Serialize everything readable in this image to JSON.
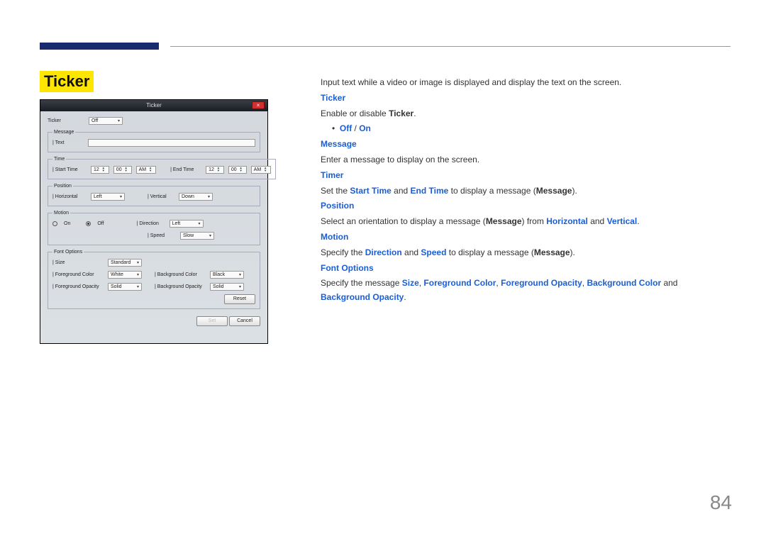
{
  "page_number": "84",
  "section_title": "Ticker",
  "dialog": {
    "title": "Ticker",
    "close_x": "×",
    "ticker_label": "Ticker",
    "ticker_value": "Off",
    "message_legend": "Message",
    "message_text_label": "Text",
    "message_text_value": "",
    "time_legend": "Time",
    "start_time_label": "Start Time",
    "start_h": "12",
    "start_m": "00",
    "start_ap": "AM",
    "end_time_label": "End Time",
    "end_h": "12",
    "end_m": "00",
    "end_ap": "AM",
    "position_legend": "Position",
    "horizontal_label": "Horizontal",
    "horizontal_value": "Left",
    "vertical_label": "Vertical",
    "vertical_value": "Down",
    "motion_legend": "Motion",
    "on_label": "On",
    "off_label": "Off",
    "direction_label": "Direction",
    "direction_value": "Left",
    "speed_label": "Speed",
    "speed_value": "Slow",
    "font_legend": "Font Options",
    "size_label": "Size",
    "size_value": "Standard",
    "fg_color_label": "Foreground Color",
    "fg_color_value": "White",
    "bg_color_label": "Background Color",
    "bg_color_value": "Black",
    "fg_op_label": "Foreground Opacity",
    "fg_op_value": "Solid",
    "bg_op_label": "Background Opacity",
    "bg_op_value": "Solid",
    "reset_label": "Reset",
    "set_label": "Set",
    "cancel_label": "Cancel"
  },
  "content": {
    "intro": "Input text while a video or image is displayed and display the text on the screen.",
    "ticker_hd": "Ticker",
    "ticker_pre": "Enable or disable ",
    "ticker_b": "Ticker",
    "bullet_dot": "•",
    "off": "Off",
    "slash": " / ",
    "on": "On",
    "message_hd": "Message",
    "message_txt": "Enter a message to display on the screen.",
    "timer_hd": "Timer",
    "timer_pre": "Set the ",
    "timer_start": "Start Time",
    "timer_and": " and ",
    "timer_end": "End Time",
    "timer_mid": " to display a message (",
    "timer_msg": "Message",
    "timer_post": ").",
    "position_hd": "Position",
    "pos_pre": "Select an orientation to display a message (",
    "pos_msg": "Message",
    "pos_mid": ") from ",
    "pos_h": "Horizontal",
    "pos_and": " and ",
    "pos_v": "Vertical",
    "pos_post": ".",
    "motion_hd": "Motion",
    "mot_pre": "Specify the ",
    "mot_dir": "Direction",
    "mot_and": " and ",
    "mot_spd": "Speed",
    "mot_mid": " to display a message (",
    "mot_msg": "Message",
    "mot_post": ").",
    "font_hd": "Font Options",
    "font_pre": "Specify the message ",
    "font_size": "Size",
    "c1": ", ",
    "font_fgc": "Foreground Color",
    "c2": ", ",
    "font_fgo": "Foreground Opacity",
    "c3": ", ",
    "font_bgc": "Background Color",
    "font_and": " and ",
    "font_bgo": "Background Opacity",
    "font_post": "."
  }
}
